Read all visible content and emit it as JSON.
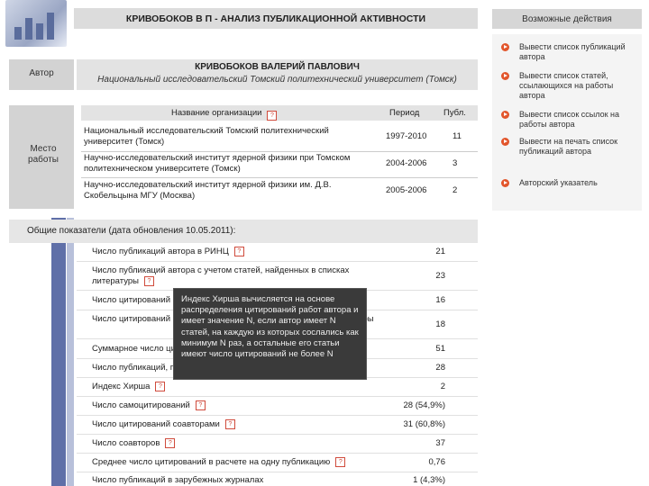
{
  "page": {
    "title": "КРИВОБОКОВ В П - АНАЛИЗ ПУБЛИКАЦИОННОЙ АКТИВНОСТИ"
  },
  "author": {
    "label": "Автор",
    "name": "КРИВОБОКОВ ВАЛЕРИЙ ПАВЛОВИЧ",
    "org": "Национальный исследовательский Томский политехнический университет (Томск)"
  },
  "workplace": {
    "label": "Место работы",
    "headers": {
      "org": "Название организации",
      "period": "Период",
      "pubs": "Публ."
    },
    "rows": [
      {
        "name": "Национальный исследовательский Томский политехнический университет (Томск)",
        "period": "1997-2010",
        "pubs": "11"
      },
      {
        "name": "Научно-исследовательский институт ядерной физики при Томском политехническом университете (Томск)",
        "period": "2004-2006",
        "pubs": "3"
      },
      {
        "name": "Научно-исследовательский институт ядерной физики им. Д.В. Скобельцына МГУ (Москва)",
        "period": "2005-2006",
        "pubs": "2"
      }
    ]
  },
  "indicators": {
    "heading": "Общие показатели (дата обновления 10.05.2011):",
    "items": [
      {
        "label": "Число публикаций автора в РИНЦ",
        "value": "21"
      },
      {
        "label": "Число публикаций автора с учетом статей, найденных в списках литературы",
        "value": "23"
      },
      {
        "label": "Число цитирований",
        "value": "16"
      },
      {
        "label": "Число цитирований с учетом статей, найденных в списках литературы",
        "value": "18"
      },
      {
        "label": "Суммарное число цитирований",
        "value": "51"
      },
      {
        "label": "Число публикаций, процитировавших работы автора",
        "value": "28"
      },
      {
        "label": "Индекс Хирша",
        "value": "2"
      },
      {
        "label": "Число самоцитирований",
        "value": "28 (54,9%)"
      },
      {
        "label": "Число цитирований соавторами",
        "value": "31 (60,8%)"
      },
      {
        "label": "Число соавторов",
        "value": "37"
      },
      {
        "label": "Среднее число цитирований в расчете на одну публикацию",
        "value": "0,76"
      },
      {
        "label": "Число публикаций в зарубежных журналах",
        "value": "1 (4,3%)"
      }
    ]
  },
  "tooltip": {
    "text": "Индекс Хирша вычисляется на основе распределения цитирований работ автора и имеет значение N, если автор имеет N статей, на каждую из которых сослались как минимум N раз, а остальные его статьи имеют число цитирований не более N"
  },
  "actions": {
    "heading": "Возможные действия",
    "items": [
      "Вывести список публикаций автора",
      "Вывести список статей, ссылающихся на работы автора",
      "Вывести список ссылок на работы автора",
      "Вывести на печать список публикаций автора",
      "Авторский указатель"
    ]
  },
  "icons": {
    "help": "help-icon",
    "action": "arrow-circle-icon"
  },
  "colors": {
    "accent": "#e2552b",
    "stripe": "#5f6fa8",
    "help": "#d04b3c"
  }
}
